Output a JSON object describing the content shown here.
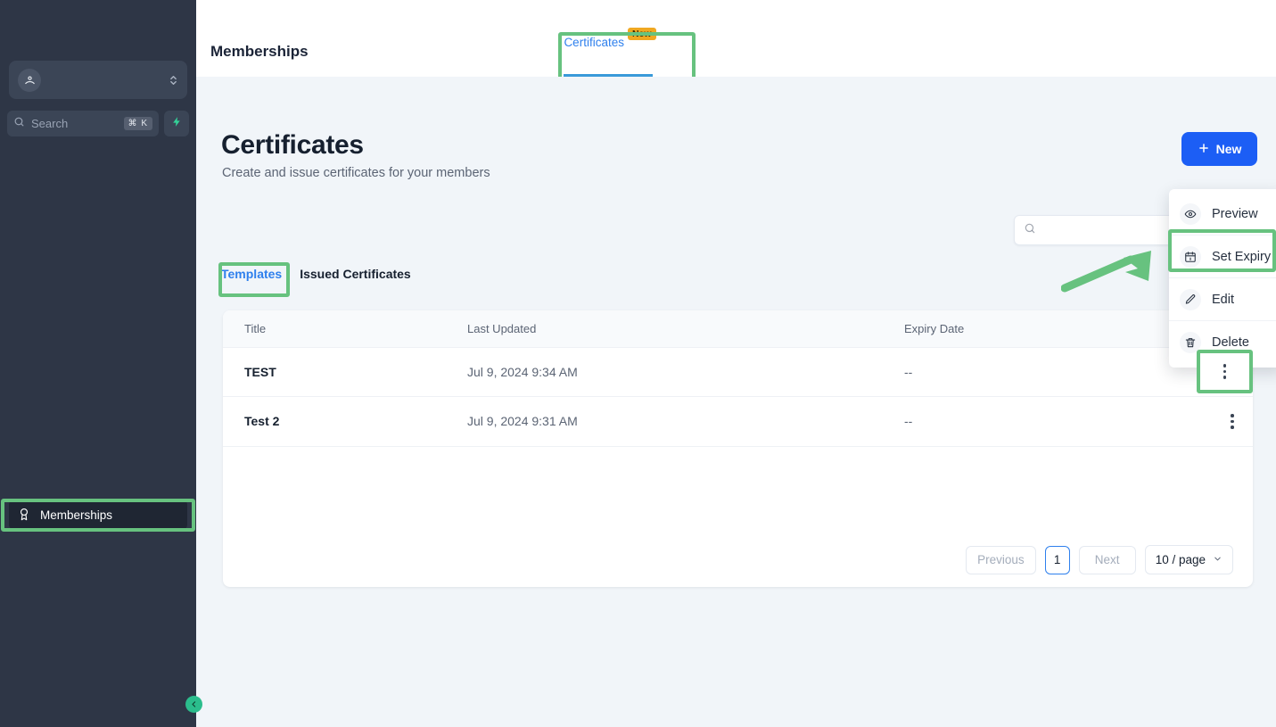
{
  "sidebar": {
    "account": {
      "icon": "account-avatar-icon",
      "caret": "chevron-updown-icon"
    },
    "search": {
      "placeholder": "Search",
      "shortcut": "⌘ K",
      "icon": "search-icon"
    },
    "quick_action": {
      "icon": "bolt-icon"
    },
    "nav": [
      {
        "label": "Memberships",
        "icon": "award-icon",
        "active": true
      }
    ],
    "collapse": {
      "icon": "chevron-left-icon"
    }
  },
  "topbar": {
    "title": "Memberships",
    "tab": {
      "label": "Certificates",
      "badge": "New"
    }
  },
  "main": {
    "title": "Certificates",
    "subtitle": "Create and issue certificates for your members",
    "new_button": {
      "label": "New",
      "icon": "plus-icon"
    },
    "search": {
      "value": "",
      "placeholder": "",
      "icon": "search-icon"
    },
    "subtabs": [
      {
        "label": "Templates",
        "active": true
      },
      {
        "label": "Issued Certificates",
        "active": false
      }
    ],
    "table": {
      "columns": [
        "Title",
        "Last Updated",
        "Expiry Date",
        ""
      ],
      "rows": [
        {
          "title": "TEST",
          "last_updated": "Jul 9, 2024 9:34 AM",
          "expiry_date": "--"
        },
        {
          "title": "Test 2",
          "last_updated": "Jul 9, 2024 9:31 AM",
          "expiry_date": "--"
        }
      ]
    },
    "pagination": {
      "previous": "Previous",
      "page": "1",
      "next": "Next",
      "page_size": "10 / page",
      "page_size_icon": "chevron-down-icon"
    }
  },
  "context_menu": {
    "items": [
      {
        "label": "Preview",
        "icon": "eye-icon"
      },
      {
        "label": "Set Expiry",
        "icon": "calendar-icon",
        "highlighted": true
      },
      {
        "label": "Edit",
        "icon": "pencil-icon"
      },
      {
        "label": "Delete",
        "icon": "trash-icon"
      }
    ]
  },
  "annotations": {
    "highlight_color": "#67c27f",
    "arrow": "green-arrow-pointing-to-set-expiry"
  },
  "colors": {
    "sidebar_bg": "#2e3646",
    "accent_blue": "#2f80ed",
    "primary_button": "#1c5ef5",
    "badge_orange": "#f0a821",
    "content_bg": "#f1f5f9"
  }
}
